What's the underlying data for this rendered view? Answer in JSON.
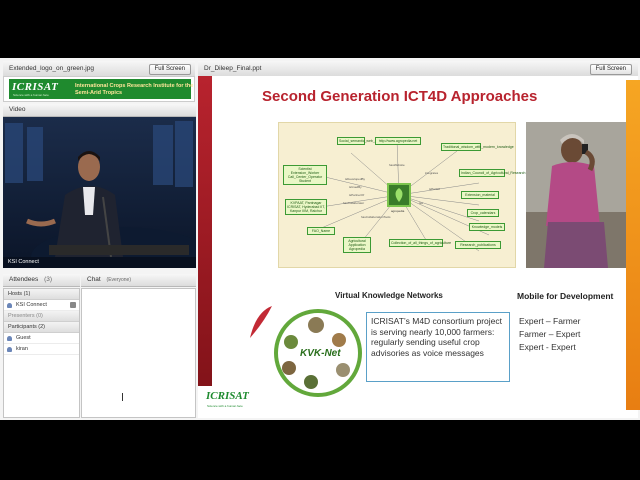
{
  "left_pod": {
    "file_name": "Extended_logo_on_green.jpg",
    "fullscreen_label": "Full Screen",
    "logo_word": "ICRISAT",
    "logo_sub": "Science with a human face",
    "logo_org": "International Crops Research Institute for the Semi-Arid Tropics"
  },
  "video": {
    "header": "Video",
    "caption": "KSI Connect"
  },
  "attendees": {
    "header": "Attendees",
    "count": "(3)",
    "hosts_label": "Hosts (1)",
    "host_name": "KSI Connect",
    "presenters_label": "Presenters (0)",
    "participants_label": "Participants (2)",
    "participants": [
      "Guest",
      "kiran"
    ]
  },
  "chat": {
    "header": "Chat",
    "scope": "(Everyone)"
  },
  "share_pod": {
    "file_name": "Dr_Dileep_Final.ppt",
    "fullscreen_label": "Full Screen"
  },
  "slide": {
    "title": "Second Generation ICT4D Approaches",
    "ontology_nodes": [
      "Social_semantic_web_application_for_agriculture",
      "http://www.agropedia.net",
      "Traditional_wisdom_with_modern_knowledge",
      "Scientist Extension_Worker Call_Center_Operator Student",
      "Indian_Council_of_Agricultural_Research",
      "Extension_material",
      "KVPAAT, Pantnagar ICRISAT, Hyderabad IIT, Kanpur IIIM, Raichur",
      "Crop_calendars",
      "Knowledge_models",
      "FAO_Name",
      "Agricultural Application Agropedia",
      "Collection_of_all_things_of_agriculture",
      "Research_publications"
    ],
    "ontology_edges": [
      "hasWebsite",
      "integrates",
      "isPartOf",
      "isDevelopedBy",
      "isPartnerOf",
      "isUsedBy",
      "hasCollaborator",
      "isa",
      "hasCollaborationTools",
      "agropedia"
    ],
    "vkn_title": "Virtual Knowledge Networks",
    "vkn_logo": "KVK-Net",
    "vkn_text": "ICRISAT’s M4D consortium project is serving nearly 10,000 farmers: regularly sending useful crop advisories as voice messages",
    "mobile_title": "Mobile for Development",
    "mobile_lines": [
      "Expert – Farmer",
      "Farmer – Expert",
      "Expert - Expert"
    ],
    "logo_word": "ICRISAT",
    "logo_sub": "Science with a human face"
  },
  "colors": {
    "accent_red": "#b8232e",
    "icrisat_green": "#1f8a2e",
    "sidebar_orange": "#f6a623"
  }
}
